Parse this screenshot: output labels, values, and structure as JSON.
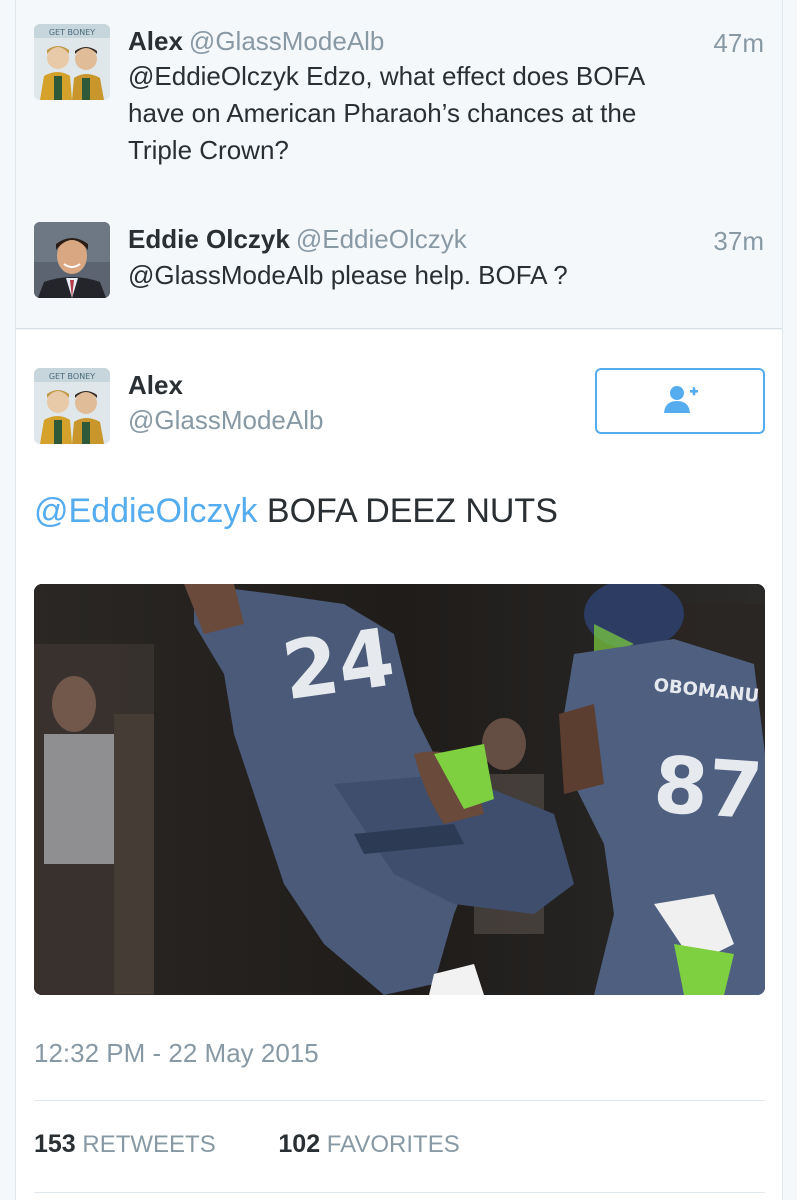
{
  "replies": [
    {
      "name": "Alex",
      "handle": "@GlassModeAlb",
      "time": "47m",
      "text_lines": [
        "@EddieOlczyk Edzo, what effect does BOFA",
        "have on American Pharaoh’s chances at the",
        "Triple Crown?"
      ],
      "avatar_badge": "GET BONEY"
    },
    {
      "name": "Eddie Olczyk",
      "handle": "@EddieOlczyk",
      "time": "37m",
      "text_lines": [
        "@GlassModeAlb please help.  BOFA ?"
      ]
    }
  ],
  "main": {
    "name": "Alex",
    "handle": "@GlassModeAlb",
    "avatar_badge": "GET BONEY",
    "mention": "@EddieOlczyk",
    "text": " BOFA DEEZ NUTS",
    "timestamp": "12:32 PM - 22 May 2015",
    "media": {
      "jersey_left": "24",
      "jersey_right": "87",
      "nameplate_right": "OBOMANU"
    },
    "stats": {
      "retweets_count": "153",
      "retweets_label": "RETWEETS",
      "favorites_count": "102",
      "favorites_label": "FAVORITES"
    }
  },
  "colors": {
    "accent": "#55acee",
    "muted": "#8899a6",
    "text": "#292f33",
    "reply_bg": "#f5f8fa"
  },
  "icons": {
    "follow": "add-user-icon"
  }
}
